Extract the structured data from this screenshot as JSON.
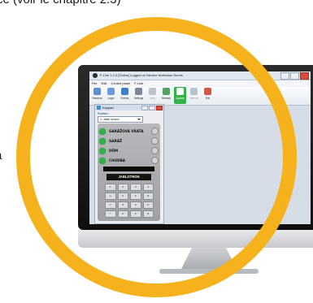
{
  "caption": "ce (voir le chapitre 2.3)",
  "side_text": {
    "line1": "a",
    "line2": "r"
  },
  "window": {
    "title": "F-Link 1.2.0 [Online] Logged on Service technician Servis",
    "menu": [
      "File",
      "Edit",
      "Control panel",
      "F-Link"
    ],
    "toolbar": [
      {
        "label": "Readout",
        "icon": "readout-icon",
        "color": "#5f8fd1"
      },
      {
        "label": "Login",
        "icon": "login-icon",
        "color": "#6b9bd6"
      },
      {
        "label": "Events",
        "icon": "events-icon",
        "color": "#3b7fcf"
      },
      {
        "label": "Settings",
        "icon": "settings-icon",
        "color": "#7c8896"
      },
      {
        "label": "Help",
        "icon": "help-icon",
        "color": "#b9c3cf"
      },
      {
        "label": "Refresh",
        "icon": "refresh-icon",
        "color": "#52a35f"
      },
      {
        "label": "Update",
        "icon": "update-icon",
        "color": "#2d8f40"
      },
      {
        "label": "Internet",
        "icon": "internet-icon",
        "color": "#b9c3cf"
      },
      {
        "label": "Exit",
        "icon": "exit-icon",
        "color": "#d8553f"
      }
    ]
  },
  "keypad": {
    "title": "Keypad",
    "field_label": "Position:",
    "selected": "1: Jablo school",
    "sections": [
      "GARÁŽOVÁ VRATA",
      "GARÁŽ",
      "DŮM",
      "CHODBA"
    ],
    "brand": "JABLOTRON",
    "keys": [
      "1",
      "2",
      "3",
      "A",
      "4",
      "5",
      "6",
      "B",
      "7",
      "8",
      "9",
      "C",
      "*",
      "0",
      "#",
      "D"
    ]
  },
  "colors": {
    "ring": "#f6b21c",
    "led": "#2fb344",
    "accent": "#34b24a"
  }
}
